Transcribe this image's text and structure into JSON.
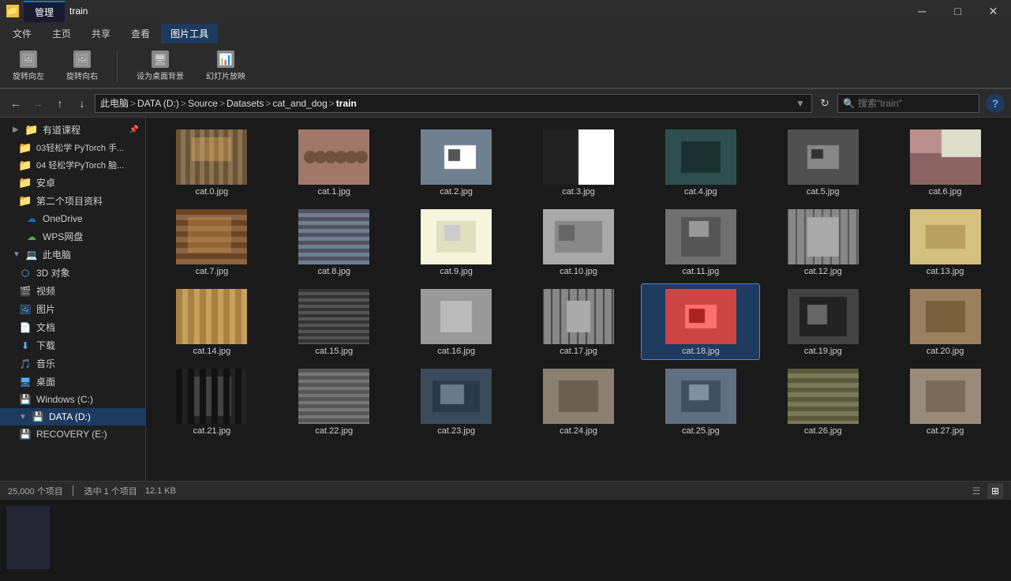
{
  "window": {
    "title": "train",
    "tab": "管理"
  },
  "ribbon_tabs": [
    "文件",
    "主页",
    "共享",
    "查看",
    "图片工具"
  ],
  "ribbon_active_tab": "图片工具",
  "nav": {
    "back_disabled": false,
    "forward_disabled": true,
    "up_disabled": false,
    "breadcrumbs": [
      "此电脑",
      "DATA (D:)",
      "Source",
      "Datasets",
      "cat_and_dog",
      "train"
    ],
    "search_placeholder": "搜索\"train\""
  },
  "sidebar": {
    "items": [
      {
        "label": "有道课程",
        "type": "folder",
        "pinned": true
      },
      {
        "label": "03轻松学 PyTorch 手...",
        "type": "folder"
      },
      {
        "label": "04 轻松学PyTorch 脑...",
        "type": "folder"
      },
      {
        "label": "安卓",
        "type": "folder"
      },
      {
        "label": "第二个项目资料",
        "type": "folder"
      },
      {
        "label": "OneDrive",
        "type": "cloud"
      },
      {
        "label": "WPS网盘",
        "type": "cloud"
      },
      {
        "label": "此电脑",
        "type": "pc"
      },
      {
        "label": "3D 对象",
        "type": "folder3d"
      },
      {
        "label": "视频",
        "type": "video"
      },
      {
        "label": "图片",
        "type": "image"
      },
      {
        "label": "文档",
        "type": "doc"
      },
      {
        "label": "下载",
        "type": "download"
      },
      {
        "label": "音乐",
        "type": "music"
      },
      {
        "label": "桌面",
        "type": "desktop"
      },
      {
        "label": "Windows (C:)",
        "type": "drive_c"
      },
      {
        "label": "DATA (D:)",
        "type": "drive_d",
        "selected": true
      },
      {
        "label": "RECOVERY (E:)",
        "type": "drive_e"
      }
    ]
  },
  "files": [
    {
      "name": "cat.0.jpg",
      "color": "#8B7355",
      "selected": false
    },
    {
      "name": "cat.1.jpg",
      "color": "#A0522D",
      "selected": false
    },
    {
      "name": "cat.2.jpg",
      "color": "#778899",
      "selected": false
    },
    {
      "name": "cat.3.jpg",
      "color": "#D3D3D3",
      "selected": false
    },
    {
      "name": "cat.4.jpg",
      "color": "#2F4F4F",
      "selected": false
    },
    {
      "name": "cat.5.jpg",
      "color": "#696969",
      "selected": false
    },
    {
      "name": "cat.6.jpg",
      "color": "#BC8F8F",
      "selected": false
    },
    {
      "name": "cat.7.jpg",
      "color": "#8B4513",
      "selected": false
    },
    {
      "name": "cat.8.jpg",
      "color": "#708090",
      "selected": false
    },
    {
      "name": "cat.9.jpg",
      "color": "#F5F5DC",
      "selected": false
    },
    {
      "name": "cat.10.jpg",
      "color": "#A9A9A9",
      "selected": false
    },
    {
      "name": "cat.11.jpg",
      "color": "#808080",
      "selected": false
    },
    {
      "name": "cat.12.jpg",
      "color": "#B8B8B8",
      "selected": false
    },
    {
      "name": "cat.13.jpg",
      "color": "#FFFACD",
      "selected": false
    },
    {
      "name": "cat.14.jpg",
      "color": "#D2B48C",
      "selected": false
    },
    {
      "name": "cat.15.jpg",
      "color": "#696969",
      "selected": false
    },
    {
      "name": "cat.16.jpg",
      "color": "#A0A0A0",
      "selected": false
    },
    {
      "name": "cat.17.jpg",
      "color": "#9E9E9E",
      "selected": false
    },
    {
      "name": "cat.18.jpg",
      "color": "#CC4444",
      "selected": true
    },
    {
      "name": "cat.19.jpg",
      "color": "#555555",
      "selected": false
    },
    {
      "name": "cat.20.jpg",
      "color": "#8B7355",
      "selected": false
    },
    {
      "name": "cat.21.jpg",
      "color": "#333333",
      "selected": false
    },
    {
      "name": "cat.22.jpg",
      "color": "#777777",
      "selected": false
    },
    {
      "name": "cat.23.jpg",
      "color": "#444455",
      "selected": false
    },
    {
      "name": "cat.24.jpg",
      "color": "#888877",
      "selected": false
    },
    {
      "name": "cat.25.jpg",
      "color": "#5A6A7A",
      "selected": false
    },
    {
      "name": "cat.26.jpg",
      "color": "#7A7A6A",
      "selected": false
    },
    {
      "name": "cat.27.jpg",
      "color": "#9A8A7A",
      "selected": false
    }
  ],
  "status": {
    "total": "25,000 个项目",
    "selected": "选中 1 个项目",
    "size": "12.1 KB"
  }
}
